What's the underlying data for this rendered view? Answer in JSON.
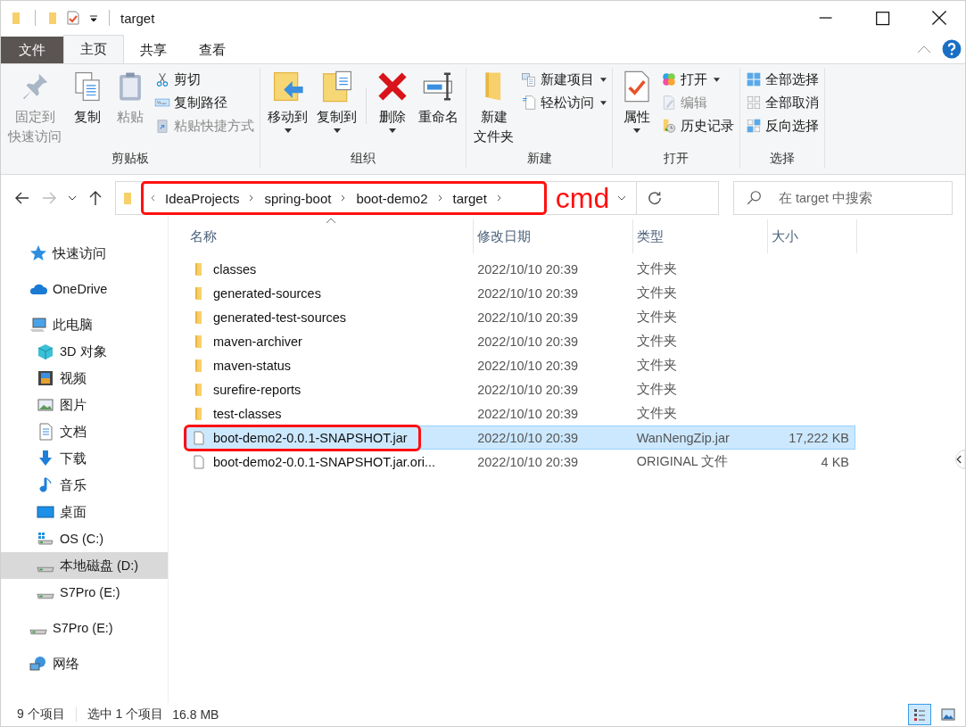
{
  "window": {
    "title": "target"
  },
  "ribbon_tabs": [
    {
      "label": "文件",
      "kind": "file",
      "selected": false
    },
    {
      "label": "主页",
      "kind": "tab",
      "selected": true
    },
    {
      "label": "共享",
      "kind": "tab",
      "selected": false
    },
    {
      "label": "查看",
      "kind": "tab",
      "selected": false
    }
  ],
  "ribbon_groups": [
    {
      "label": "剪贴板",
      "items": [
        {
          "kind": "large",
          "lines": [
            "固定到",
            "快速访问"
          ],
          "disabled": true,
          "dropdown": false
        },
        {
          "kind": "large",
          "lines": [
            "复制"
          ],
          "disabled": false,
          "dropdown": false
        },
        {
          "kind": "large",
          "lines": [
            "粘贴"
          ],
          "disabled": true,
          "dropdown": false
        },
        {
          "kind": "small",
          "lines": [
            "剪切"
          ],
          "disabled": false,
          "dropdown": false
        },
        {
          "kind": "small",
          "lines": [
            "复制路径"
          ],
          "disabled": false,
          "dropdown": false
        },
        {
          "kind": "small",
          "lines": [
            "粘贴快捷方式"
          ],
          "disabled": true,
          "dropdown": false
        }
      ]
    },
    {
      "label": "组织",
      "items": [
        {
          "kind": "large",
          "lines": [
            "移动到"
          ],
          "disabled": false,
          "dropdown": true
        },
        {
          "kind": "large",
          "lines": [
            "复制到"
          ],
          "disabled": false,
          "dropdown": true
        },
        {
          "kind": "separator"
        },
        {
          "kind": "large",
          "lines": [
            "删除"
          ],
          "disabled": false,
          "dropdown": true
        },
        {
          "kind": "large",
          "lines": [
            "重命名"
          ],
          "disabled": false,
          "dropdown": false
        }
      ]
    },
    {
      "label": "新建",
      "items": [
        {
          "kind": "large",
          "lines": [
            "新建",
            "文件夹"
          ],
          "disabled": false,
          "dropdown": false
        },
        {
          "kind": "small",
          "lines": [
            "新建项目"
          ],
          "disabled": false,
          "dropdown": true
        },
        {
          "kind": "small",
          "lines": [
            "轻松访问"
          ],
          "disabled": false,
          "dropdown": true
        }
      ]
    },
    {
      "label": "打开",
      "items": [
        {
          "kind": "large",
          "lines": [
            "属性"
          ],
          "disabled": false,
          "dropdown": true
        },
        {
          "kind": "small",
          "lines": [
            "打开"
          ],
          "disabled": false,
          "dropdown": true
        },
        {
          "kind": "small",
          "lines": [
            "编辑"
          ],
          "disabled": true,
          "dropdown": false
        },
        {
          "kind": "small",
          "lines": [
            "历史记录"
          ],
          "disabled": false,
          "dropdown": false
        }
      ]
    },
    {
      "label": "选择",
      "items": [
        {
          "kind": "small",
          "lines": [
            "全部选择"
          ],
          "disabled": false,
          "dropdown": false
        },
        {
          "kind": "small",
          "lines": [
            "全部取消"
          ],
          "disabled": false,
          "dropdown": false
        },
        {
          "kind": "small",
          "lines": [
            "反向选择"
          ],
          "disabled": false,
          "dropdown": false
        }
      ]
    }
  ],
  "address_bar": {
    "crumbs": [
      "IdeaProjects",
      "spring-boot",
      "boot-demo2",
      "target"
    ],
    "highlighted": true,
    "note": "cmd",
    "search_placeholder": "在 target 中搜索"
  },
  "sidebar": [
    {
      "label": "快速访问",
      "selected": false
    },
    {
      "label": "OneDrive",
      "selected": false
    },
    {
      "label": "此电脑",
      "selected": false,
      "children": [
        {
          "label": "3D 对象",
          "selected": false
        },
        {
          "label": "视频",
          "selected": false
        },
        {
          "label": "图片",
          "selected": false
        },
        {
          "label": "文档",
          "selected": false
        },
        {
          "label": "下载",
          "selected": false
        },
        {
          "label": "音乐",
          "selected": false
        },
        {
          "label": "桌面",
          "selected": false
        },
        {
          "label": "OS (C:)",
          "selected": false
        },
        {
          "label": "本地磁盘 (D:)",
          "selected": true
        },
        {
          "label": "S7Pro (E:)",
          "selected": false
        }
      ]
    },
    {
      "label": "S7Pro (E:)",
      "selected": false
    },
    {
      "label": "网络",
      "selected": false
    }
  ],
  "columns": [
    "名称",
    "修改日期",
    "类型",
    "大小"
  ],
  "rows": [
    {
      "kind": "folder",
      "name": "classes",
      "date": "2022/10/10 20:39",
      "type": "文件夹",
      "selected": false,
      "highlighted": false
    },
    {
      "kind": "folder",
      "name": "generated-sources",
      "date": "2022/10/10 20:39",
      "type": "文件夹",
      "selected": false,
      "highlighted": false
    },
    {
      "kind": "folder",
      "name": "generated-test-sources",
      "date": "2022/10/10 20:39",
      "type": "文件夹",
      "selected": false,
      "highlighted": false
    },
    {
      "kind": "folder",
      "name": "maven-archiver",
      "date": "2022/10/10 20:39",
      "type": "文件夹",
      "selected": false,
      "highlighted": false
    },
    {
      "kind": "folder",
      "name": "maven-status",
      "date": "2022/10/10 20:39",
      "type": "文件夹",
      "selected": false,
      "highlighted": false
    },
    {
      "kind": "folder",
      "name": "surefire-reports",
      "date": "2022/10/10 20:39",
      "type": "文件夹",
      "selected": false,
      "highlighted": false
    },
    {
      "kind": "folder",
      "name": "test-classes",
      "date": "2022/10/10 20:39",
      "type": "文件夹",
      "selected": false,
      "highlighted": false
    },
    {
      "kind": "file",
      "name": "boot-demo2-0.0.1-SNAPSHOT.jar",
      "date": "2022/10/10 20:39",
      "type": "WanNengZip.jar",
      "size": "17,222 KB",
      "selected": true,
      "highlighted": true
    },
    {
      "kind": "file",
      "name": "boot-demo2-0.0.1-SNAPSHOT.jar.ori...",
      "date": "2022/10/10 20:39",
      "type": "ORIGINAL 文件",
      "size": "4 KB",
      "selected": false,
      "highlighted": false
    }
  ],
  "status_bar": {
    "count": "9 个项目",
    "selection": "选中 1 个项目",
    "size": "16.8 MB",
    "views": [
      {
        "kind": "details",
        "selected": true
      },
      {
        "kind": "large_icons",
        "selected": false
      }
    ]
  }
}
